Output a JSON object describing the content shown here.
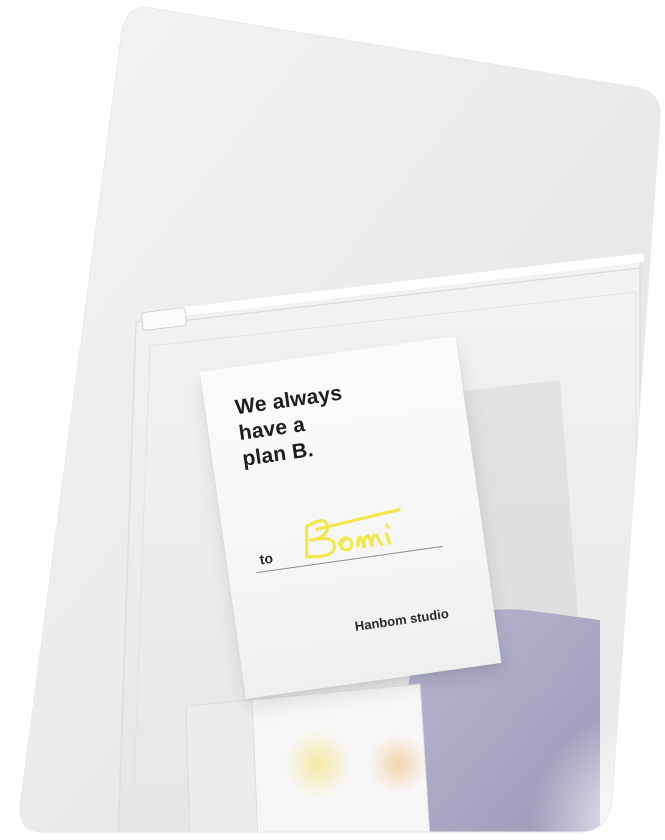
{
  "card": {
    "headline": [
      "We always",
      "have a",
      "plan B."
    ],
    "to_label": "to",
    "recipient": "Bomi",
    "brand": "Hanbom studio"
  },
  "colors": {
    "background": "#ffffff",
    "surface": "#ebebeb",
    "signature": "#f2e84b",
    "fabric": "#a9a7c4"
  }
}
